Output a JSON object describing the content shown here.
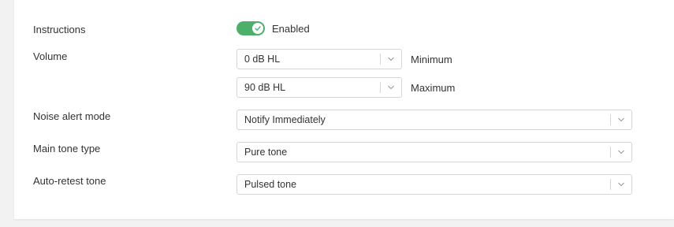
{
  "settings": {
    "instructions": {
      "label": "Instructions",
      "toggle_state": "Enabled",
      "toggle_color": "#4caf6a"
    },
    "volume": {
      "label": "Volume",
      "min_value": "0 dB HL",
      "min_label": "Minimum",
      "max_value": "90 dB HL",
      "max_label": "Maximum"
    },
    "noise_alert_mode": {
      "label": "Noise alert mode",
      "value": "Notify Immediately"
    },
    "main_tone_type": {
      "label": "Main tone type",
      "value": "Pure tone"
    },
    "auto_retest_tone": {
      "label": "Auto-retest tone",
      "value": "Pulsed tone"
    }
  },
  "icons": {
    "toggle_knob": "check-icon",
    "dropdown": "chevron-down-icon"
  }
}
